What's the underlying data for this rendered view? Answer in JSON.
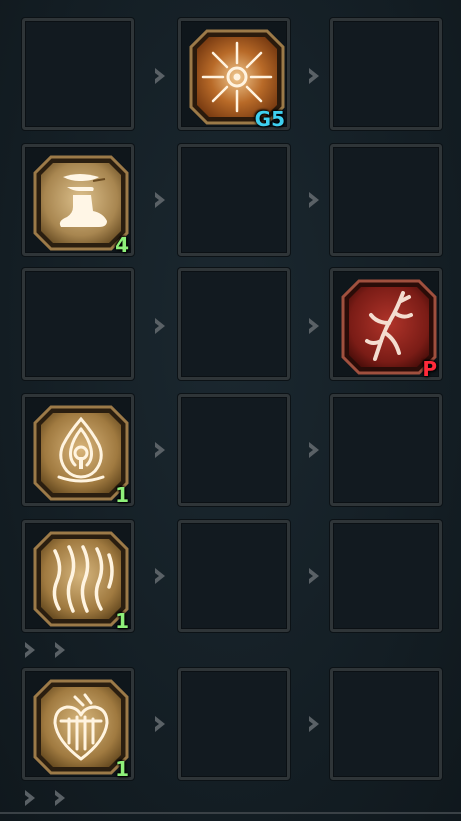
{
  "colors": {
    "background": "#152027",
    "slot_border": "#2f3538",
    "arrow": "#5a6166",
    "badge_green": "#8ef07a",
    "badge_cyan": "#3fd0f0",
    "badge_red": "#ff2a3a",
    "bronze_frame": "#8a6a3a",
    "red_frame": "#8b2a22"
  },
  "grid": {
    "rows": [
      {
        "slots": [
          {
            "icon": null,
            "badge": null
          },
          {
            "icon": "radiant-burst-icon",
            "badge": "G5",
            "badge_color": "cyan"
          },
          {
            "icon": null,
            "badge": null
          }
        ]
      },
      {
        "slots": [
          {
            "icon": "swift-boot-icon",
            "badge": "4",
            "badge_color": "green"
          },
          {
            "icon": null,
            "badge": null
          },
          {
            "icon": null,
            "badge": null
          }
        ]
      },
      {
        "slots": [
          {
            "icon": null,
            "badge": null
          },
          {
            "icon": null,
            "badge": null
          },
          {
            "icon": "branching-root-icon",
            "badge": "P",
            "badge_color": "red"
          }
        ]
      },
      {
        "slots": [
          {
            "icon": "flame-lock-icon",
            "badge": "1",
            "badge_color": "green"
          },
          {
            "icon": null,
            "badge": null
          },
          {
            "icon": null,
            "badge": null
          }
        ]
      },
      {
        "slots": [
          {
            "icon": "woven-vines-icon",
            "badge": "1",
            "badge_color": "green"
          },
          {
            "icon": null,
            "badge": null
          },
          {
            "icon": null,
            "badge": null
          }
        ]
      },
      {
        "slots": [
          {
            "icon": "heart-cage-icon",
            "badge": "1",
            "badge_color": "green"
          },
          {
            "icon": null,
            "badge": null
          },
          {
            "icon": null,
            "badge": null
          }
        ]
      }
    ]
  },
  "badges": {
    "r0c1": "G5",
    "r1c0": "4",
    "r2c2": "P",
    "r3c0": "1",
    "r4c0": "1",
    "r5c0": "1"
  }
}
